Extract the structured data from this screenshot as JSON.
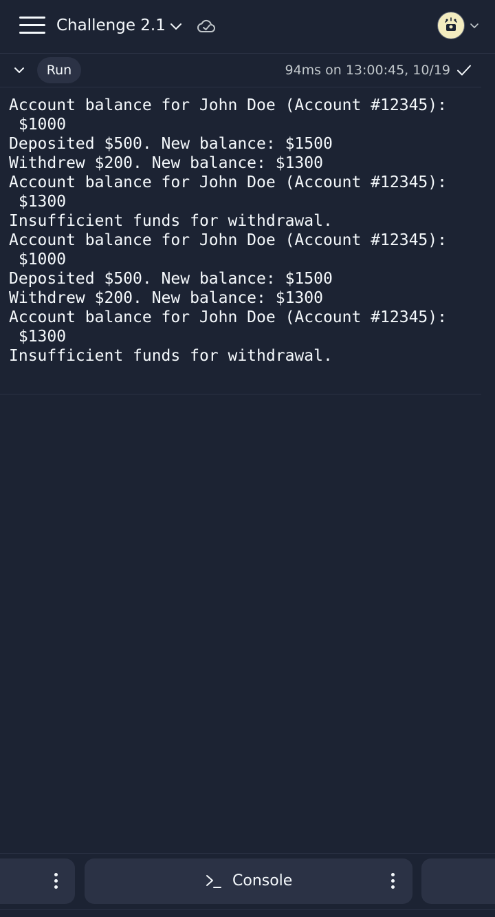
{
  "header": {
    "menu_icon": "hamburger-menu-icon",
    "project_title": "Challenge 2.1",
    "title_dropdown_icon": "chevron-down-icon",
    "sync_icon": "cloud-check-icon",
    "avatar_icon": "avatar",
    "avatar_dropdown_icon": "chevron-down-icon"
  },
  "run_bar": {
    "collapse_icon": "chevron-down-icon",
    "run_label": "Run",
    "status_text": "94ms on 13:00:45, 10/19",
    "status_icon": "checkmark-icon"
  },
  "console": {
    "lines": [
      "Account balance for John Doe (Account #12345):",
      " $1000",
      "Deposited $500. New balance: $1500",
      "Withdrew $200. New balance: $1300",
      "Account balance for John Doe (Account #12345):",
      " $1300",
      "Insufficient funds for withdrawal.",
      "Account balance for John Doe (Account #12345):",
      " $1000",
      "Deposited $500. New balance: $1500",
      "Withdrew $200. New balance: $1300",
      "Account balance for John Doe (Account #12345):",
      " $1300",
      "Insufficient funds for withdrawal."
    ]
  },
  "bottom_tabs": {
    "console_label": "Console",
    "console_icon": "terminal-prompt-icon",
    "more_icon": "kebab-menu-icon"
  },
  "colors": {
    "background": "#1c2333",
    "surface": "#2b3245",
    "text": "#f5f9fc",
    "muted_text": "#c2c8cc",
    "avatar_bg": "#f3ecc0"
  }
}
